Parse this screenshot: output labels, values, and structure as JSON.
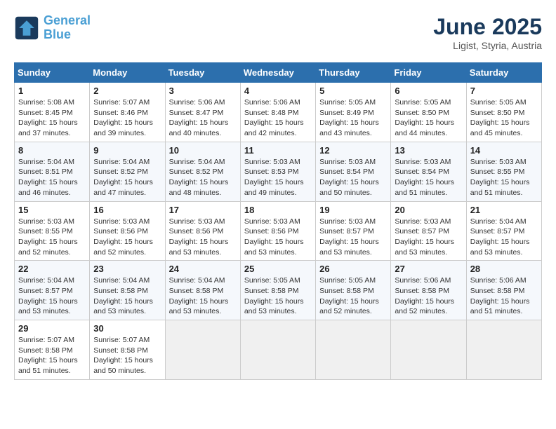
{
  "logo": {
    "line1": "General",
    "line2": "Blue"
  },
  "title": "June 2025",
  "subtitle": "Ligist, Styria, Austria",
  "weekdays": [
    "Sunday",
    "Monday",
    "Tuesday",
    "Wednesday",
    "Thursday",
    "Friday",
    "Saturday"
  ],
  "weeks": [
    [
      {
        "day": "1",
        "info": "Sunrise: 5:08 AM\nSunset: 8:45 PM\nDaylight: 15 hours\nand 37 minutes."
      },
      {
        "day": "2",
        "info": "Sunrise: 5:07 AM\nSunset: 8:46 PM\nDaylight: 15 hours\nand 39 minutes."
      },
      {
        "day": "3",
        "info": "Sunrise: 5:06 AM\nSunset: 8:47 PM\nDaylight: 15 hours\nand 40 minutes."
      },
      {
        "day": "4",
        "info": "Sunrise: 5:06 AM\nSunset: 8:48 PM\nDaylight: 15 hours\nand 42 minutes."
      },
      {
        "day": "5",
        "info": "Sunrise: 5:05 AM\nSunset: 8:49 PM\nDaylight: 15 hours\nand 43 minutes."
      },
      {
        "day": "6",
        "info": "Sunrise: 5:05 AM\nSunset: 8:50 PM\nDaylight: 15 hours\nand 44 minutes."
      },
      {
        "day": "7",
        "info": "Sunrise: 5:05 AM\nSunset: 8:50 PM\nDaylight: 15 hours\nand 45 minutes."
      }
    ],
    [
      {
        "day": "8",
        "info": "Sunrise: 5:04 AM\nSunset: 8:51 PM\nDaylight: 15 hours\nand 46 minutes."
      },
      {
        "day": "9",
        "info": "Sunrise: 5:04 AM\nSunset: 8:52 PM\nDaylight: 15 hours\nand 47 minutes."
      },
      {
        "day": "10",
        "info": "Sunrise: 5:04 AM\nSunset: 8:52 PM\nDaylight: 15 hours\nand 48 minutes."
      },
      {
        "day": "11",
        "info": "Sunrise: 5:03 AM\nSunset: 8:53 PM\nDaylight: 15 hours\nand 49 minutes."
      },
      {
        "day": "12",
        "info": "Sunrise: 5:03 AM\nSunset: 8:54 PM\nDaylight: 15 hours\nand 50 minutes."
      },
      {
        "day": "13",
        "info": "Sunrise: 5:03 AM\nSunset: 8:54 PM\nDaylight: 15 hours\nand 51 minutes."
      },
      {
        "day": "14",
        "info": "Sunrise: 5:03 AM\nSunset: 8:55 PM\nDaylight: 15 hours\nand 51 minutes."
      }
    ],
    [
      {
        "day": "15",
        "info": "Sunrise: 5:03 AM\nSunset: 8:55 PM\nDaylight: 15 hours\nand 52 minutes."
      },
      {
        "day": "16",
        "info": "Sunrise: 5:03 AM\nSunset: 8:56 PM\nDaylight: 15 hours\nand 52 minutes."
      },
      {
        "day": "17",
        "info": "Sunrise: 5:03 AM\nSunset: 8:56 PM\nDaylight: 15 hours\nand 53 minutes."
      },
      {
        "day": "18",
        "info": "Sunrise: 5:03 AM\nSunset: 8:56 PM\nDaylight: 15 hours\nand 53 minutes."
      },
      {
        "day": "19",
        "info": "Sunrise: 5:03 AM\nSunset: 8:57 PM\nDaylight: 15 hours\nand 53 minutes."
      },
      {
        "day": "20",
        "info": "Sunrise: 5:03 AM\nSunset: 8:57 PM\nDaylight: 15 hours\nand 53 minutes."
      },
      {
        "day": "21",
        "info": "Sunrise: 5:04 AM\nSunset: 8:57 PM\nDaylight: 15 hours\nand 53 minutes."
      }
    ],
    [
      {
        "day": "22",
        "info": "Sunrise: 5:04 AM\nSunset: 8:57 PM\nDaylight: 15 hours\nand 53 minutes."
      },
      {
        "day": "23",
        "info": "Sunrise: 5:04 AM\nSunset: 8:58 PM\nDaylight: 15 hours\nand 53 minutes."
      },
      {
        "day": "24",
        "info": "Sunrise: 5:04 AM\nSunset: 8:58 PM\nDaylight: 15 hours\nand 53 minutes."
      },
      {
        "day": "25",
        "info": "Sunrise: 5:05 AM\nSunset: 8:58 PM\nDaylight: 15 hours\nand 53 minutes."
      },
      {
        "day": "26",
        "info": "Sunrise: 5:05 AM\nSunset: 8:58 PM\nDaylight: 15 hours\nand 52 minutes."
      },
      {
        "day": "27",
        "info": "Sunrise: 5:06 AM\nSunset: 8:58 PM\nDaylight: 15 hours\nand 52 minutes."
      },
      {
        "day": "28",
        "info": "Sunrise: 5:06 AM\nSunset: 8:58 PM\nDaylight: 15 hours\nand 51 minutes."
      }
    ],
    [
      {
        "day": "29",
        "info": "Sunrise: 5:07 AM\nSunset: 8:58 PM\nDaylight: 15 hours\nand 51 minutes."
      },
      {
        "day": "30",
        "info": "Sunrise: 5:07 AM\nSunset: 8:58 PM\nDaylight: 15 hours\nand 50 minutes."
      },
      {
        "day": "",
        "info": ""
      },
      {
        "day": "",
        "info": ""
      },
      {
        "day": "",
        "info": ""
      },
      {
        "day": "",
        "info": ""
      },
      {
        "day": "",
        "info": ""
      }
    ]
  ]
}
